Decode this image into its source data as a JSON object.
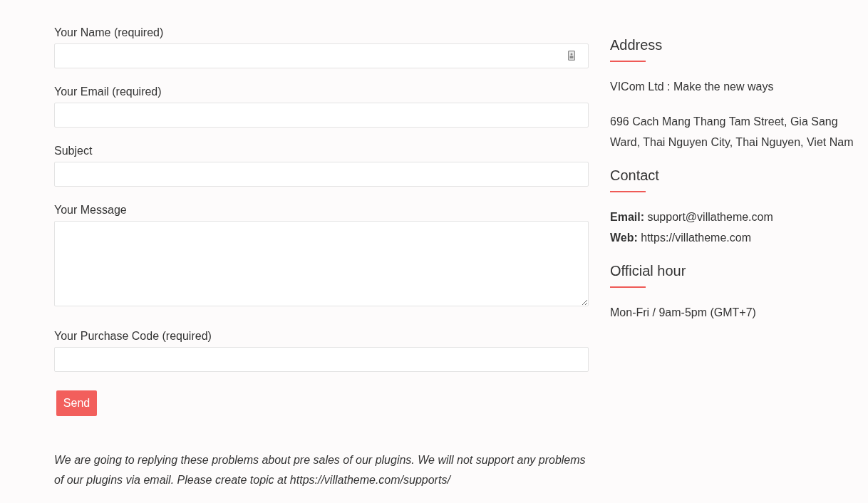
{
  "form": {
    "fields": [
      {
        "kind": "text",
        "label": "Your Name (required)",
        "autofill": true
      },
      {
        "kind": "text",
        "label": "Your Email (required)",
        "autofill": false
      },
      {
        "kind": "text",
        "label": "Subject",
        "autofill": false
      },
      {
        "kind": "textarea",
        "label": "Your Message",
        "autofill": false
      },
      {
        "kind": "text",
        "label": "Your Purchase Code (required)",
        "autofill": false
      }
    ],
    "send_button": "Send",
    "note": "We are going to replying these problems about pre sales of our plugins. We will not support any problems of our plugins via email. Please create topic at https://villatheme.com/supports/"
  },
  "sidebar": {
    "sections": [
      {
        "title": "Address",
        "paragraphs": [
          [
            "VICom Ltd : Make the new ways"
          ],
          [
            "696 Cach Mang Thang Tam Street, Gia Sang Ward, Thai Nguyen City, Thai Nguyen, Viet Nam"
          ]
        ]
      },
      {
        "title": "Contact",
        "paragraphs": [
          [
            "**Email:** support@villatheme.com",
            "**Web:** https://villatheme.com"
          ]
        ]
      },
      {
        "title": "Official hour",
        "paragraphs": [
          [
            "Mon-Fri / 9am-5pm (GMT+7)"
          ]
        ]
      }
    ]
  }
}
